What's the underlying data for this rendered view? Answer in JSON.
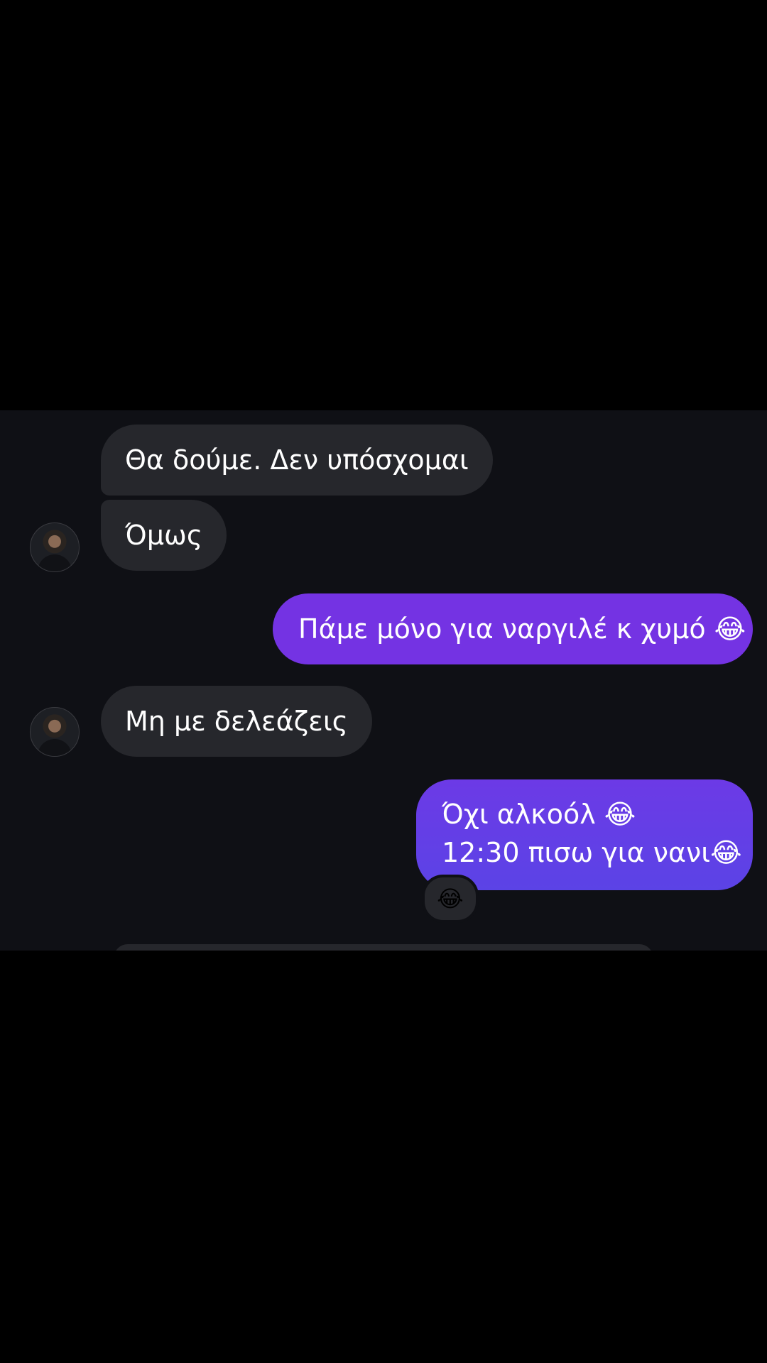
{
  "conversation": {
    "messages": [
      {
        "sender": "contact",
        "text": "Θα δούμε. Δεν υπόσχομαι"
      },
      {
        "sender": "contact",
        "text": "Όμως"
      },
      {
        "sender": "me",
        "text": "Πάμε μόνο για ναργιλέ κ χυμό 😂"
      },
      {
        "sender": "contact",
        "text": "Μη με δελεάζεις"
      },
      {
        "sender": "me",
        "lines": [
          "Όχι αλκοόλ 😂",
          "12:30 πισω για νανι😂"
        ],
        "reaction": "😂"
      }
    ]
  }
}
